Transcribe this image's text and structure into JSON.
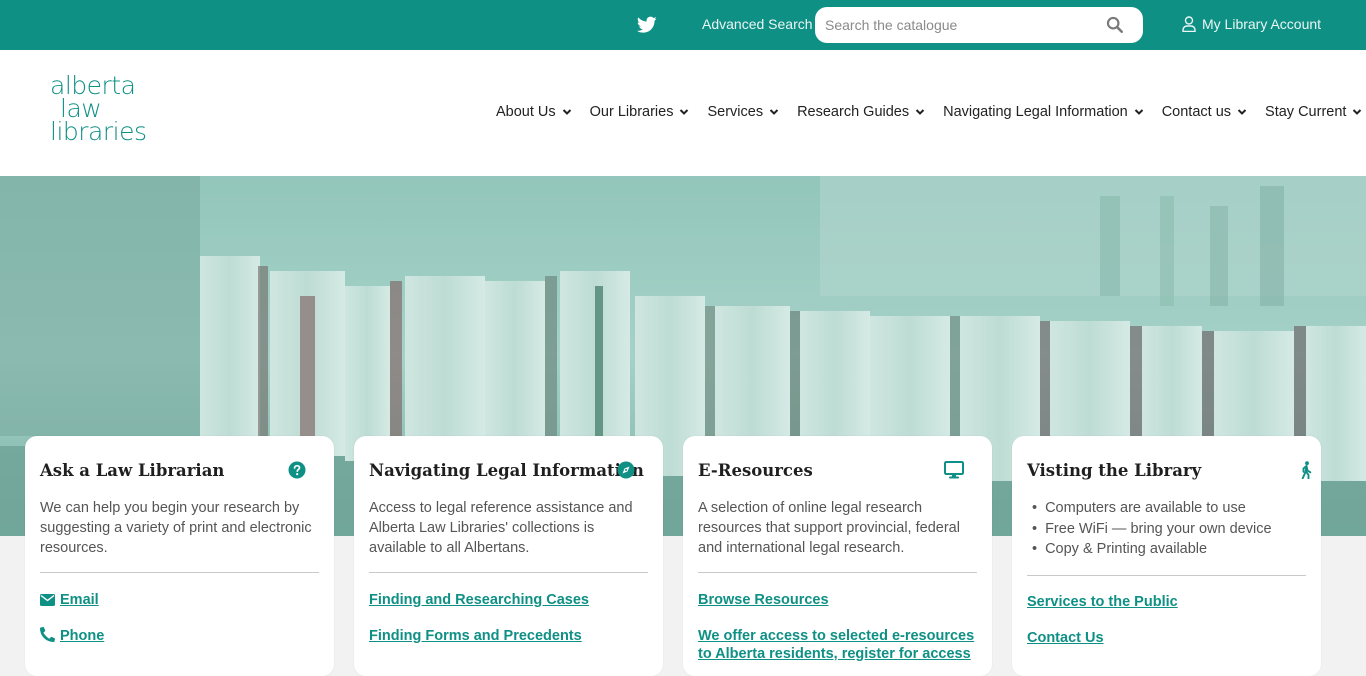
{
  "topbar": {
    "twitter_icon": "twitter-icon",
    "advanced_search": "Advanced Search",
    "search_placeholder": "Search the catalogue",
    "account_label": "My Library Account"
  },
  "logo": {
    "line1": "alberta",
    "line2": "law",
    "line3": "libraries"
  },
  "nav": [
    {
      "label": "About Us"
    },
    {
      "label": "Our Libraries"
    },
    {
      "label": "Services"
    },
    {
      "label": "Research Guides"
    },
    {
      "label": "Navigating Legal Information"
    },
    {
      "label": "Contact us"
    },
    {
      "label": "Stay Current"
    }
  ],
  "cards": [
    {
      "title": "Ask a Law Librarian",
      "icon": "question-circle-icon",
      "text": "We can help you begin your research by suggesting a variety of print and electronic resources.",
      "links": [
        "Email",
        "Phone"
      ]
    },
    {
      "title": "Navigating Legal Information",
      "icon": "compass-icon",
      "text": "Access to legal reference assistance and Alberta Law Libraries' collections is available to all Albertans.",
      "links": [
        "Finding and Researching Cases",
        "Finding Forms and Precedents"
      ]
    },
    {
      "title": "E-Resources",
      "icon": "desktop-icon",
      "text": "A selection of online legal research resources that support provincial, federal and international legal research.",
      "links": [
        "Browse Resources",
        "We offer access to selected e-resources to Alberta residents, register for access"
      ]
    },
    {
      "title": "Visting the Library",
      "icon": "walking-person-icon",
      "bullets": [
        "Computers are available to use",
        "Free WiFi — bring your own device",
        "Copy & Printing available"
      ],
      "links": [
        "Services to the Public",
        "Contact Us"
      ]
    }
  ],
  "colors": {
    "brand": "#0f9085",
    "topbar": "#0f9085",
    "link": "#0f9085",
    "text": "#222222"
  }
}
